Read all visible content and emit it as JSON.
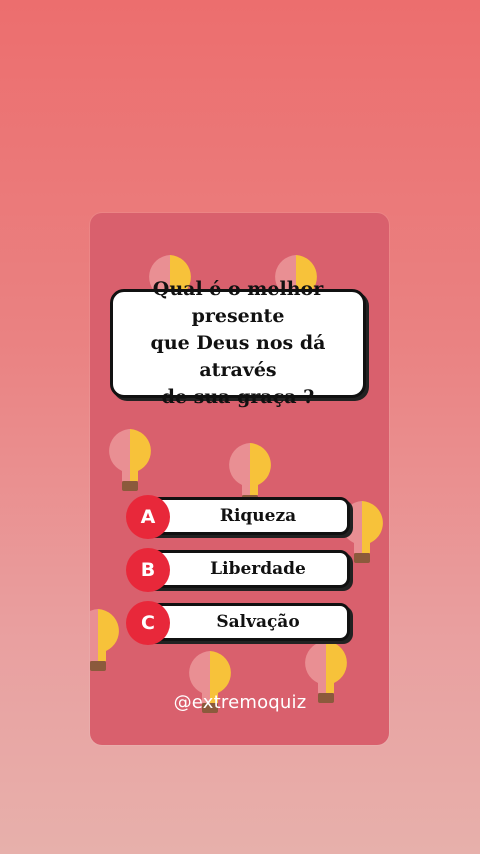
{
  "quiz": {
    "question": "Qual é o melhor presente\nque Deus nos dá através\nde sua graça ?",
    "answers": [
      {
        "letter": "A",
        "text": "Riqueza"
      },
      {
        "letter": "B",
        "text": "Liberdade"
      },
      {
        "letter": "C",
        "text": "Salvação"
      }
    ],
    "handle": "@extremoquiz"
  },
  "colors": {
    "card": "#d9606d",
    "letter_badge": "#e8283a",
    "bulb_yellow": "#f7c23a",
    "brain_pink": "#e98f93"
  },
  "background_icons": "lightbulb-brain-icon"
}
